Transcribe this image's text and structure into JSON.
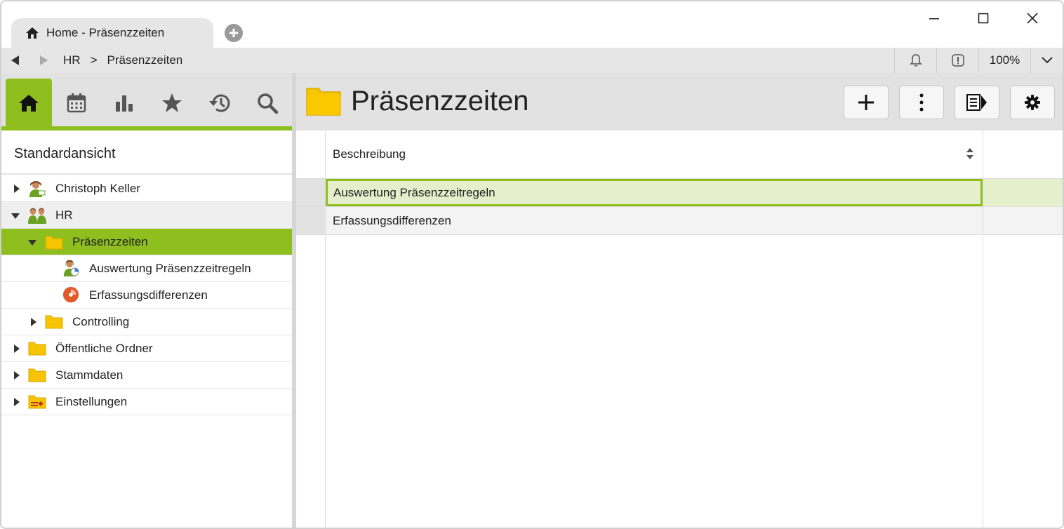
{
  "tab": {
    "label": "Home - Präsenzzeiten"
  },
  "breadcrumb": {
    "items": [
      "HR",
      "Präsenzzeiten"
    ],
    "separator": ">"
  },
  "toolbar": {
    "zoom": "100%"
  },
  "sidebar": {
    "view_title": "Standardansicht",
    "tabs": [
      "home-icon",
      "calendar-icon",
      "chart-icon",
      "star-icon",
      "history-icon",
      "search-icon"
    ],
    "tree": [
      {
        "label": "Christoph Keller"
      },
      {
        "label": "HR"
      },
      {
        "label": "Präsenzzeiten"
      },
      {
        "label": "Auswertung Präsenzzeitregeln"
      },
      {
        "label": "Erfassungsdifferenzen"
      },
      {
        "label": "Controlling"
      },
      {
        "label": "Öffentliche Ordner"
      },
      {
        "label": "Stammdaten"
      },
      {
        "label": "Einstellungen"
      }
    ]
  },
  "main": {
    "title": "Präsenzzeiten",
    "column_header": "Beschreibung",
    "rows": [
      "Auswertung Präsenzzeitregeln",
      "Erfassungsdifferenzen"
    ]
  },
  "colors": {
    "accent": "#8ebf1f",
    "folder": "#f7c400",
    "selected_row": "#e6efcc"
  }
}
